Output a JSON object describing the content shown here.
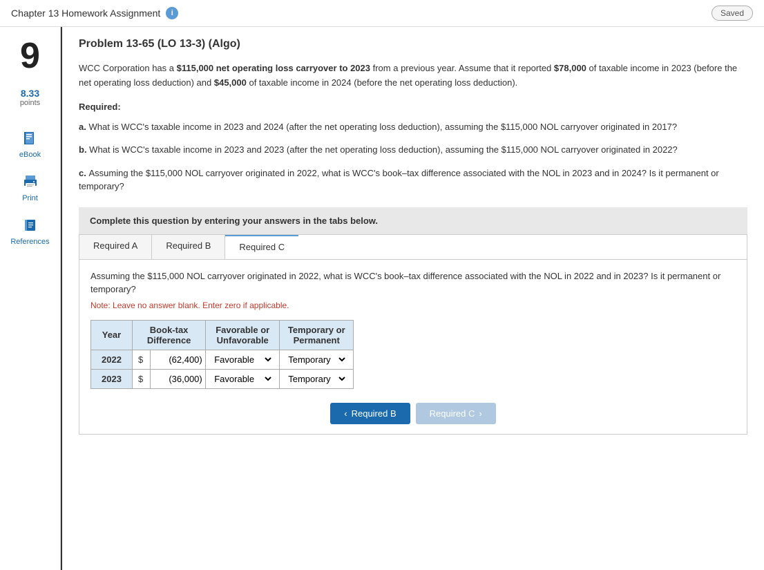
{
  "header": {
    "title": "Chapter 13 Homework Assignment",
    "info_icon": "i",
    "saved_label": "Saved"
  },
  "sidebar": {
    "question_number": "9",
    "points_value": "8.33",
    "points_label": "points",
    "items": [
      {
        "id": "ebook",
        "label": "eBook",
        "icon": "book-icon"
      },
      {
        "id": "print",
        "label": "Print",
        "icon": "print-icon"
      },
      {
        "id": "references",
        "label": "References",
        "icon": "references-icon"
      }
    ]
  },
  "problem": {
    "title": "Problem 13-65 (LO 13-3) (Algo)",
    "body": "WCC Corporation has a $115,000 net operating loss carryover to 2023 from a previous year. Assume that it reported $78,000 of taxable income in 2023 (before the net operating loss deduction) and $45,000 of taxable income in 2024 (before the net operating loss deduction).",
    "required_label": "Required:",
    "questions": [
      {
        "letter": "a.",
        "text": "What is WCC's taxable income in 2023 and 2024 (after the net operating loss deduction), assuming the $115,000 NOL carryover originated in 2017?"
      },
      {
        "letter": "b.",
        "text": "What is WCC's taxable income in 2023 and 2023 (after the net operating loss deduction), assuming the $115,000 NOL carryover originated in 2022?"
      },
      {
        "letter": "c.",
        "text": "Assuming the $115,000 NOL carryover originated in 2022, what is WCC's book–tax difference associated with the NOL in 2023 and in 2024? Is it permanent or temporary?"
      }
    ]
  },
  "complete_box": {
    "text": "Complete this question by entering your answers in the tabs below."
  },
  "tabs": [
    {
      "id": "required-a",
      "label": "Required A"
    },
    {
      "id": "required-b",
      "label": "Required B"
    },
    {
      "id": "required-c",
      "label": "Required C",
      "active": true
    }
  ],
  "tab_c": {
    "question": "Assuming the $115,000 NOL carryover originated in 2022, what is WCC's book–tax difference associated with the NOL in 2022 and in 2023? Is it permanent or temporary?",
    "note": "Note: Leave no answer blank. Enter zero if applicable.",
    "table": {
      "headers": [
        "Year",
        "Book-tax Difference",
        "Favorable or Unfavorable",
        "Temporary or Permanent"
      ],
      "rows": [
        {
          "year": "2022",
          "dollar_sign": "$",
          "amount": "(62,400)",
          "favorable": "Favorable",
          "temp_perm": "Temporary"
        },
        {
          "year": "2023",
          "dollar_sign": "$",
          "amount": "(36,000)",
          "favorable": "Favorable",
          "temp_perm": "Temporary"
        }
      ]
    },
    "favorable_options": [
      "Favorable",
      "Unfavorable"
    ],
    "temp_perm_options": [
      "Temporary",
      "Permanent"
    ]
  },
  "navigation": {
    "prev_label": "Required B",
    "next_label": "Required C"
  }
}
